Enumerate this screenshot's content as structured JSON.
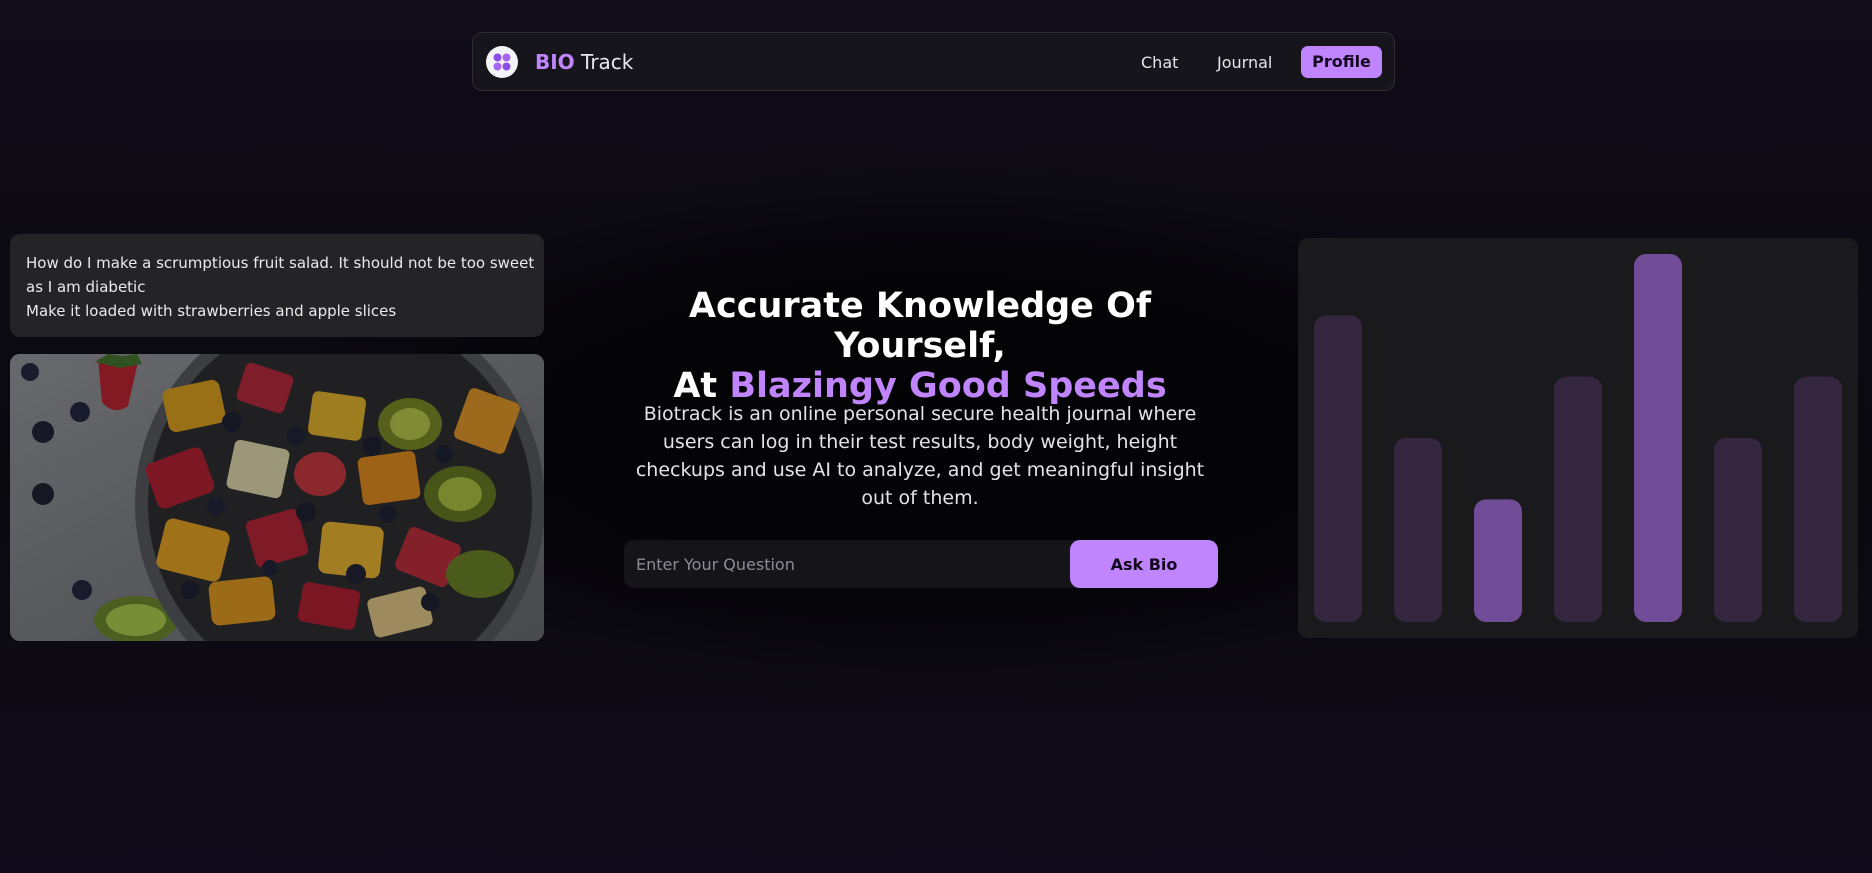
{
  "nav": {
    "brand_accent": "BIO",
    "brand_rest": "Track",
    "links": {
      "chat": "Chat",
      "journal": "Journal",
      "profile": "Profile"
    }
  },
  "chat_example": {
    "lines": [
      "How do I make a scrumptious fruit salad. It should not be too sweet",
      "as I am diabetic",
      "Make it loaded with strawberries and apple slices"
    ]
  },
  "hero": {
    "title_line1": "Accurate Knowledge Of Yourself,",
    "title_prefix": "At",
    "title_accent": "Blazingy Good Speeds",
    "description": "Biotrack is an online personal secure health journal where users can log in their test results, body weight, height checkups and use AI to analyze, and get meaningful insight out of them."
  },
  "ask": {
    "placeholder": "Enter Your Question",
    "button_label": "Ask Bio"
  },
  "colors": {
    "accent": "#c084fc",
    "bar_dim": "#35263f",
    "bar_bright": "#714d98"
  },
  "chart_data": {
    "type": "bar",
    "values": [
      5,
      3,
      2,
      4,
      6,
      3,
      4
    ],
    "highlighted": [
      false,
      false,
      true,
      false,
      true,
      false,
      false
    ],
    "ylim": [
      0,
      6
    ]
  }
}
